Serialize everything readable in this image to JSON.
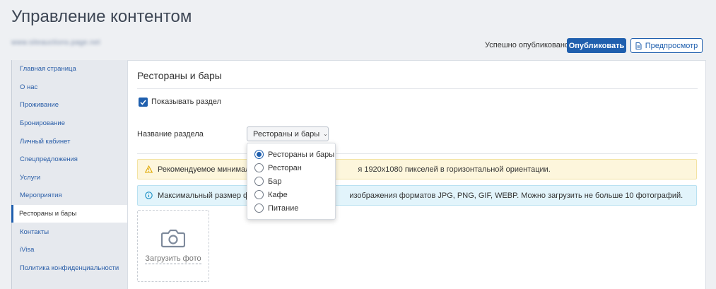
{
  "header": {
    "title": "Управление контентом",
    "site_url": "www.siteauctions.page.net",
    "status": "Успешно опубликовано",
    "publish_label": "Опубликовать",
    "preview_label": "Предпросмотр"
  },
  "sidebar": {
    "items": [
      {
        "label": "Главная страница",
        "active": false
      },
      {
        "label": "О нас",
        "active": false
      },
      {
        "label": "Проживание",
        "active": false
      },
      {
        "label": "Бронирование",
        "active": false
      },
      {
        "label": "Личный кабинет",
        "active": false
      },
      {
        "label": "Спецпредложения",
        "active": false
      },
      {
        "label": "Услуги",
        "active": false
      },
      {
        "label": "Мероприятия",
        "active": false
      },
      {
        "label": "Рестораны и бары",
        "active": true
      },
      {
        "label": "Контакты",
        "active": false
      },
      {
        "label": "iVisa",
        "active": false
      },
      {
        "label": "Политика конфиденциальности",
        "active": false
      }
    ]
  },
  "main": {
    "section_title": "Рестораны и бары",
    "show_section_label": "Показывать раздел",
    "show_section_checked": true,
    "section_name_label": "Название раздела",
    "section_name_value": "Рестораны и бары",
    "alerts": {
      "warning_visible": "Рекомендуемое минималь",
      "warning_visible_tail": "я 1920x1080 пикселей в горизонтальной ориентации.",
      "info_visible": "Максимальный размер фай",
      "info_visible_tail": "изображения форматов JPG, PNG, GIF, WEBP. Можно загрузить не больше 10 фотографий."
    },
    "upload_label": "Загрузить фото"
  },
  "dropdown": {
    "options": [
      {
        "label": "Рестораны и бары",
        "selected": true
      },
      {
        "label": "Ресторан",
        "selected": false
      },
      {
        "label": "Бар",
        "selected": false
      },
      {
        "label": "Кафе",
        "selected": false
      },
      {
        "label": "Питание",
        "selected": false
      }
    ]
  },
  "colors": {
    "accent": "#1f5fae",
    "warning_bg": "#fdf6dc",
    "info_bg": "#e2f4fb"
  }
}
